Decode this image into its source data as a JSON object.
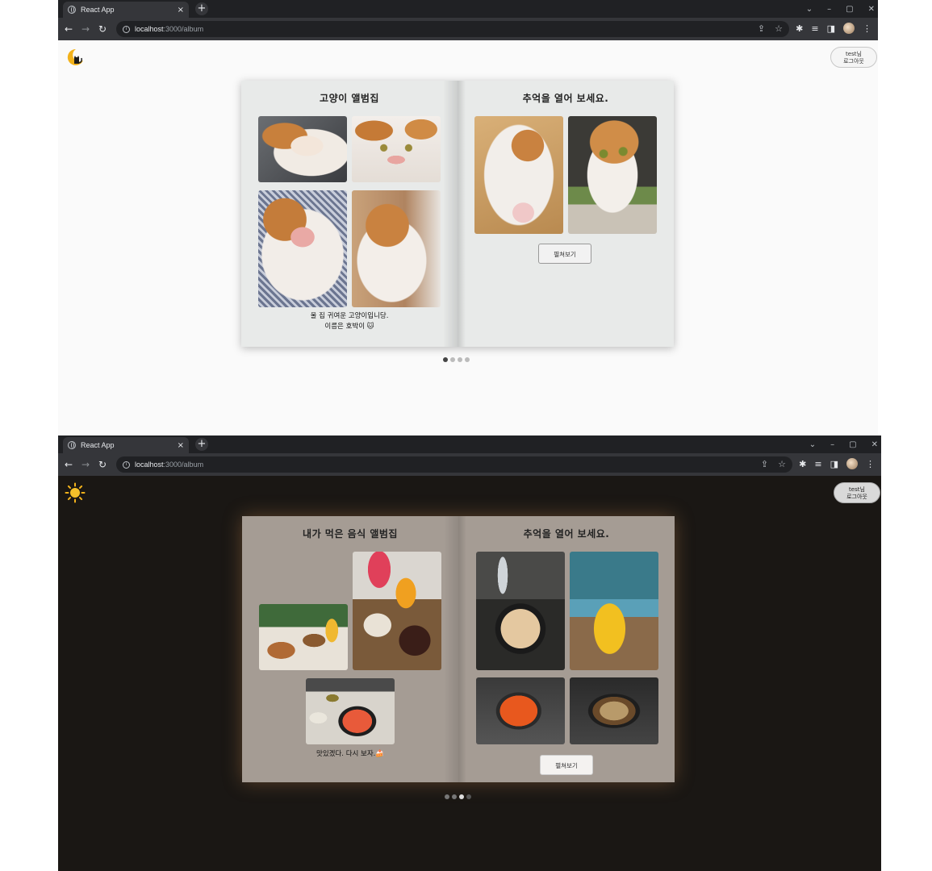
{
  "browser": {
    "tab_title": "React App",
    "tab_close": "×",
    "new_tab": "+",
    "url_host": "localhost",
    "url_path": ":3000/album",
    "window_controls": [
      "⌄",
      "–",
      "▢",
      "✕"
    ]
  },
  "screens": [
    {
      "theme": "light",
      "theme_icon": "moon-cat-icon",
      "user": {
        "name": "test님",
        "logout": "로그아웃"
      },
      "album": {
        "left_title": "고양이 앨범집",
        "caption_line1": "울 집 귀여운 고양이입니당.",
        "caption_line2": "이름은 호박이 🐱",
        "right_title": "추억을 열어 보세요.",
        "view_button": "펼쳐보기"
      },
      "pagination": {
        "count": 4,
        "active": 1
      }
    },
    {
      "theme": "dark",
      "theme_icon": "sun-icon",
      "user": {
        "name": "test님",
        "logout": "로그아웃"
      },
      "album": {
        "left_title": "내가 먹은 음식 앨범집",
        "caption_line1": "맛있겠다. 다시 보자.🍰",
        "right_title": "추억을 열어 보세요.",
        "view_button": "펼쳐보기"
      },
      "pagination": {
        "count": 4,
        "active": 3
      }
    }
  ],
  "colors": {
    "light_bg": "#fafafa",
    "light_page": "#e8eae9",
    "dark_bg": "#1a1714",
    "dark_page": "#a59c94",
    "chrome_dark": "#202124",
    "chrome_mid": "#35363a"
  }
}
